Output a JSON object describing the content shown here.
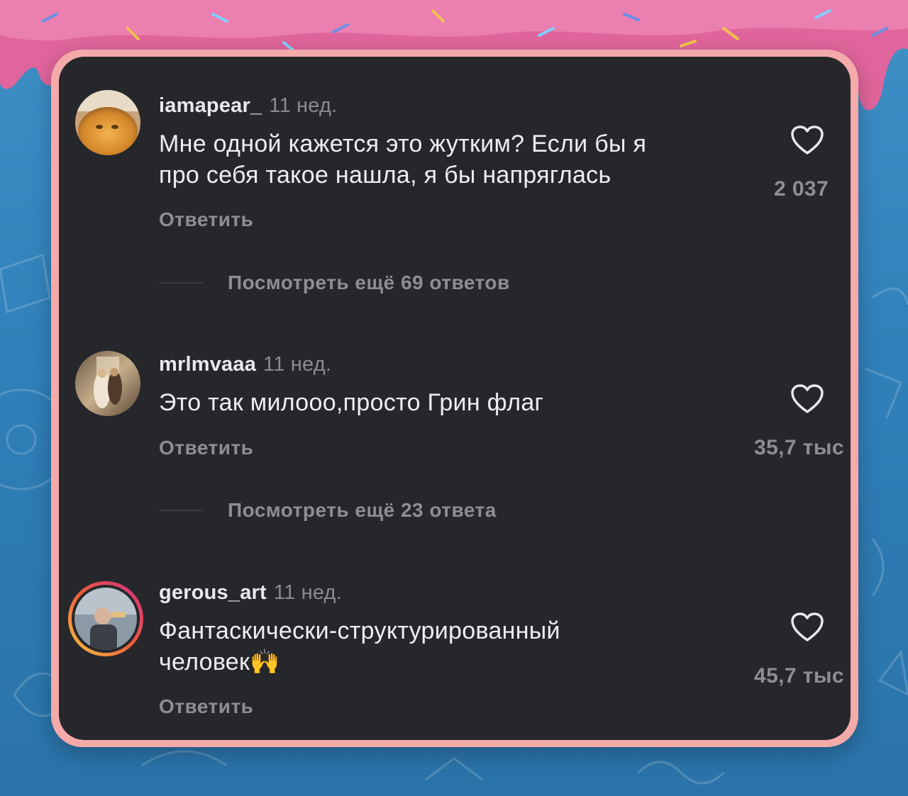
{
  "comments": [
    {
      "username": "iamapear_",
      "time": "11 нед.",
      "text_line1": "Мне одной кажется это жутким? Если бы я",
      "text_line2": "про себя такое нашла, я бы напряглась",
      "reply": "Ответить",
      "likes": "2 037",
      "view_more": "Посмотреть ещё 69 ответов"
    },
    {
      "username": "mrlmvaaa",
      "time": "11 нед.",
      "text_line1": "Это так милооо,просто Грин флаг",
      "reply": "Ответить",
      "likes": "35,7 тыс",
      "view_more": "Посмотреть ещё 23 ответа"
    },
    {
      "username": "gerous_art",
      "time": "11 нед.",
      "text_line1": "Фантаскически-структурированный",
      "text_line2": "человек",
      "emoji": "🙌",
      "reply": "Ответить",
      "likes": "45,7 тыс"
    }
  ],
  "icons": {
    "like": "heart-outline-icon"
  },
  "colors": {
    "card_bg": "#26272b",
    "frame": "#f4aaa9",
    "muted_text": "#8d8e94",
    "story_ring_start": "#f6c543",
    "story_ring_end": "#d62f8a"
  }
}
